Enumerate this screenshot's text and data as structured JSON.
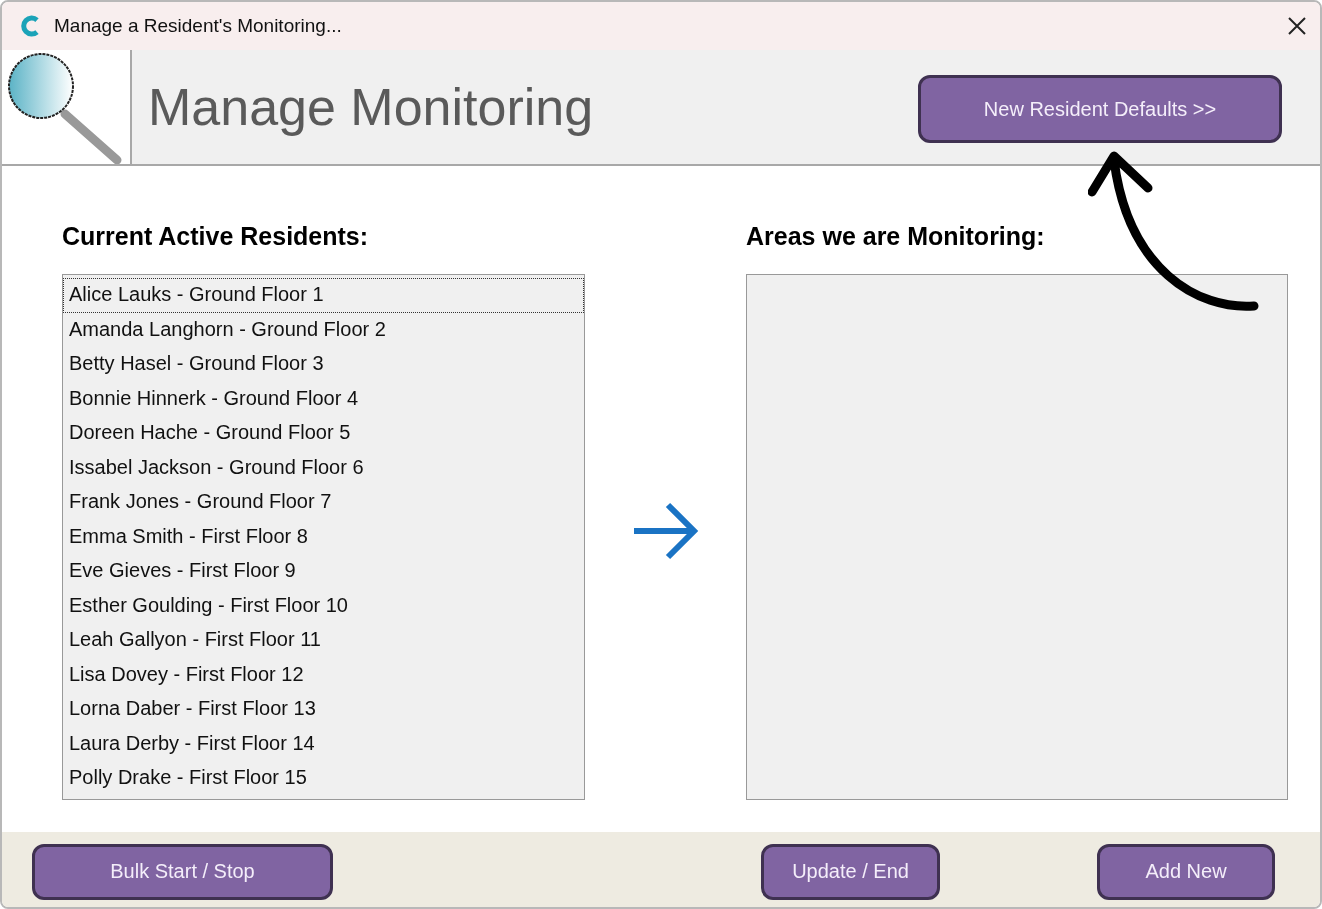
{
  "window": {
    "title": "Manage a Resident's Monitoring..."
  },
  "header": {
    "title": "Manage Monitoring",
    "defaults_button": "New Resident Defaults >>"
  },
  "residents": {
    "heading": "Current Active Residents:",
    "items": [
      {
        "label": "Alice Lauks - Ground Floor 1",
        "selected": true
      },
      {
        "label": "Amanda Langhorn - Ground Floor 2",
        "selected": false
      },
      {
        "label": "Betty Hasel - Ground Floor 3",
        "selected": false
      },
      {
        "label": "Bonnie Hinnerk - Ground Floor 4",
        "selected": false
      },
      {
        "label": "Doreen Hache - Ground Floor 5",
        "selected": false
      },
      {
        "label": "Issabel Jackson - Ground Floor 6",
        "selected": false
      },
      {
        "label": "Frank Jones - Ground Floor 7",
        "selected": false
      },
      {
        "label": "Emma Smith - First Floor 8",
        "selected": false
      },
      {
        "label": "Eve Gieves - First Floor 9",
        "selected": false
      },
      {
        "label": "Esther Goulding - First Floor 10",
        "selected": false
      },
      {
        "label": "Leah Gallyon - First Floor 11",
        "selected": false
      },
      {
        "label": "Lisa Dovey - First Floor 12",
        "selected": false
      },
      {
        "label": "Lorna Daber - First Floor 13",
        "selected": false
      },
      {
        "label": "Laura Derby - First Floor 14",
        "selected": false
      },
      {
        "label": "Polly Drake - First Floor 15",
        "selected": false
      }
    ]
  },
  "areas": {
    "heading": "Areas we are Monitoring:"
  },
  "footer_buttons": [
    "Bulk Start / Stop",
    "Update / End",
    "Add New"
  ]
}
